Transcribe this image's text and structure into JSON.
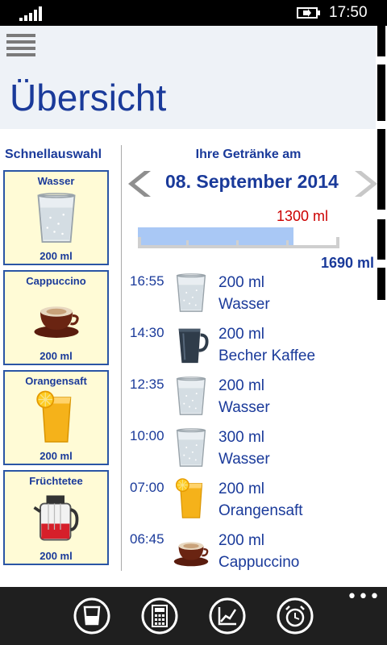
{
  "status_bar": {
    "time": "17:50"
  },
  "header": {
    "title": "Übersicht"
  },
  "quick_select": {
    "title": "Schnellauswahl",
    "items": [
      {
        "name": "Wasser",
        "amount": "200 ml",
        "icon": "water-glass-icon"
      },
      {
        "name": "Cappuccino",
        "amount": "200 ml",
        "icon": "cappuccino-cup-icon"
      },
      {
        "name": "Orangensaft",
        "amount": "200 ml",
        "icon": "orange-juice-icon"
      },
      {
        "name": "Früchtetee",
        "amount": "200 ml",
        "icon": "teapot-icon"
      }
    ]
  },
  "drinks": {
    "heading": "Ihre Getränke am",
    "date": "08. September 2014",
    "consumed": "1300 ml",
    "goal": "1690 ml",
    "progress_fraction": 0.77,
    "entries": [
      {
        "time": "16:55",
        "amount": "200 ml",
        "name": "Wasser",
        "icon": "water-glass-icon"
      },
      {
        "time": "14:30",
        "amount": "200 ml",
        "name": "Becher Kaffee",
        "icon": "coffee-mug-icon"
      },
      {
        "time": "12:35",
        "amount": "200 ml",
        "name": "Wasser",
        "icon": "water-glass-icon"
      },
      {
        "time": "10:00",
        "amount": "300 ml",
        "name": "Wasser",
        "icon": "water-glass-icon"
      },
      {
        "time": "07:00",
        "amount": "200 ml",
        "name": "Orangensaft",
        "icon": "orange-juice-icon"
      },
      {
        "time": "06:45",
        "amount": "200 ml",
        "name": "Cappuccino",
        "icon": "cappuccino-cup-icon"
      }
    ]
  },
  "app_bar": {
    "buttons": [
      "glass-icon",
      "calculator-icon",
      "chart-icon",
      "alarm-clock-icon"
    ],
    "more": "•••"
  },
  "colors": {
    "accent": "#1a3a9a",
    "consumed": "#cc0000",
    "progress": "#a9c8f5",
    "card": "#fffbd6"
  }
}
